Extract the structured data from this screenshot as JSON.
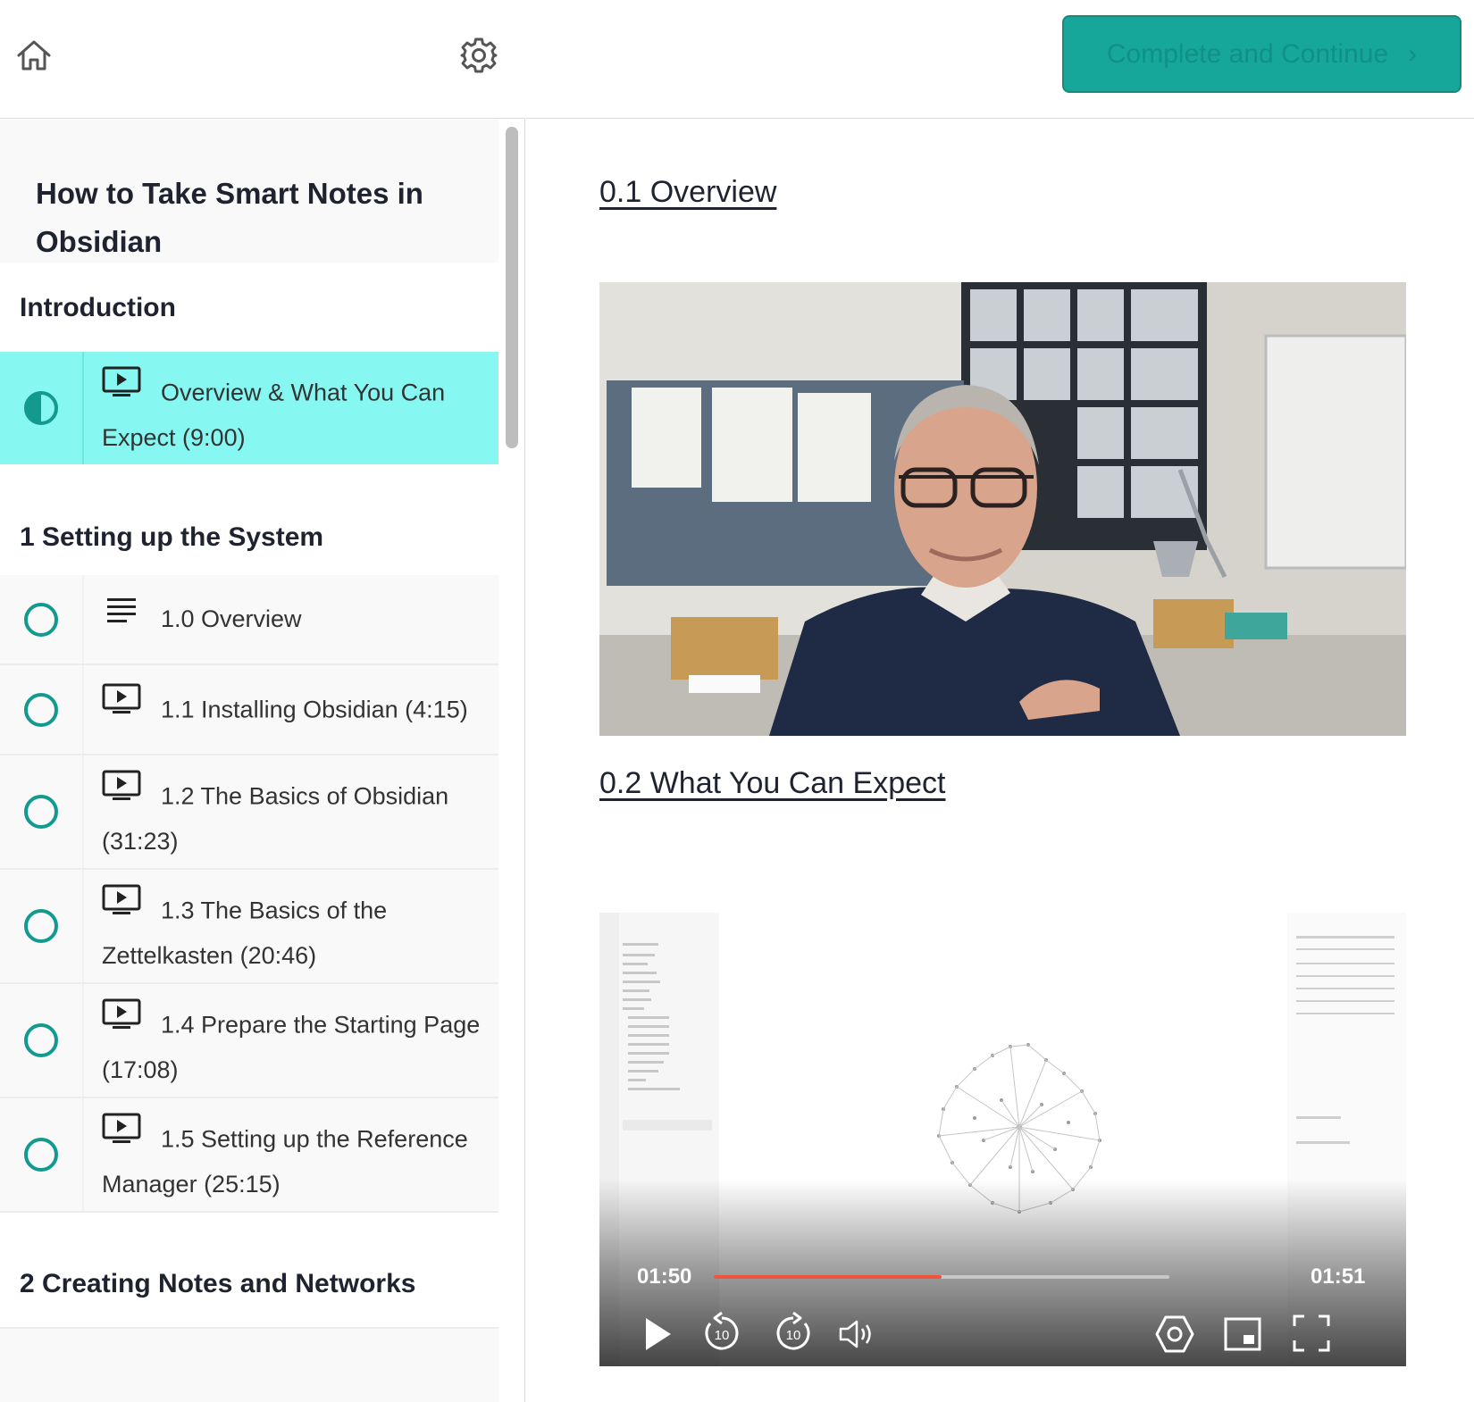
{
  "sidebar": {
    "course_title": "How to Take Smart Notes in Obsidian",
    "sections": [
      {
        "title": "Introduction",
        "lectures": [
          {
            "label": "Overview & What You Can Expect (9:00)",
            "type": "video",
            "status": "in-progress"
          }
        ]
      },
      {
        "title": "1 Setting up the System",
        "lectures": [
          {
            "label": "1.0 Overview",
            "type": "text",
            "status": "not-started"
          },
          {
            "label": "1.1 Installing Obsidian (4:15)",
            "type": "video",
            "status": "not-started"
          },
          {
            "label": "1.2 The Basics of Obsidian (31:23)",
            "type": "video",
            "status": "not-started"
          },
          {
            "label": "1.3 The Basics of the Zettelkasten (20:46)",
            "type": "video",
            "status": "not-started"
          },
          {
            "label": "1.4 Prepare the Starting Page (17:08)",
            "type": "video",
            "status": "not-started"
          },
          {
            "label": "1.5 Setting up the Reference Manager (25:15)",
            "type": "video",
            "status": "not-started"
          }
        ]
      },
      {
        "title": "2 Creating Notes and Networks",
        "lectures": []
      }
    ]
  },
  "topbar": {
    "complete_label": "Complete and Continue",
    "chevron": "›"
  },
  "main": {
    "headings": [
      "0.1 Overview",
      "0.2 What You Can Expect"
    ],
    "player": {
      "current_time": "01:50",
      "remaining_time": "01:51",
      "progress": 0.5,
      "skip_seconds": "10"
    }
  },
  "colors": {
    "accent": "#17a69a",
    "active_row": "#86f7f1",
    "progress": "#f1533b"
  }
}
